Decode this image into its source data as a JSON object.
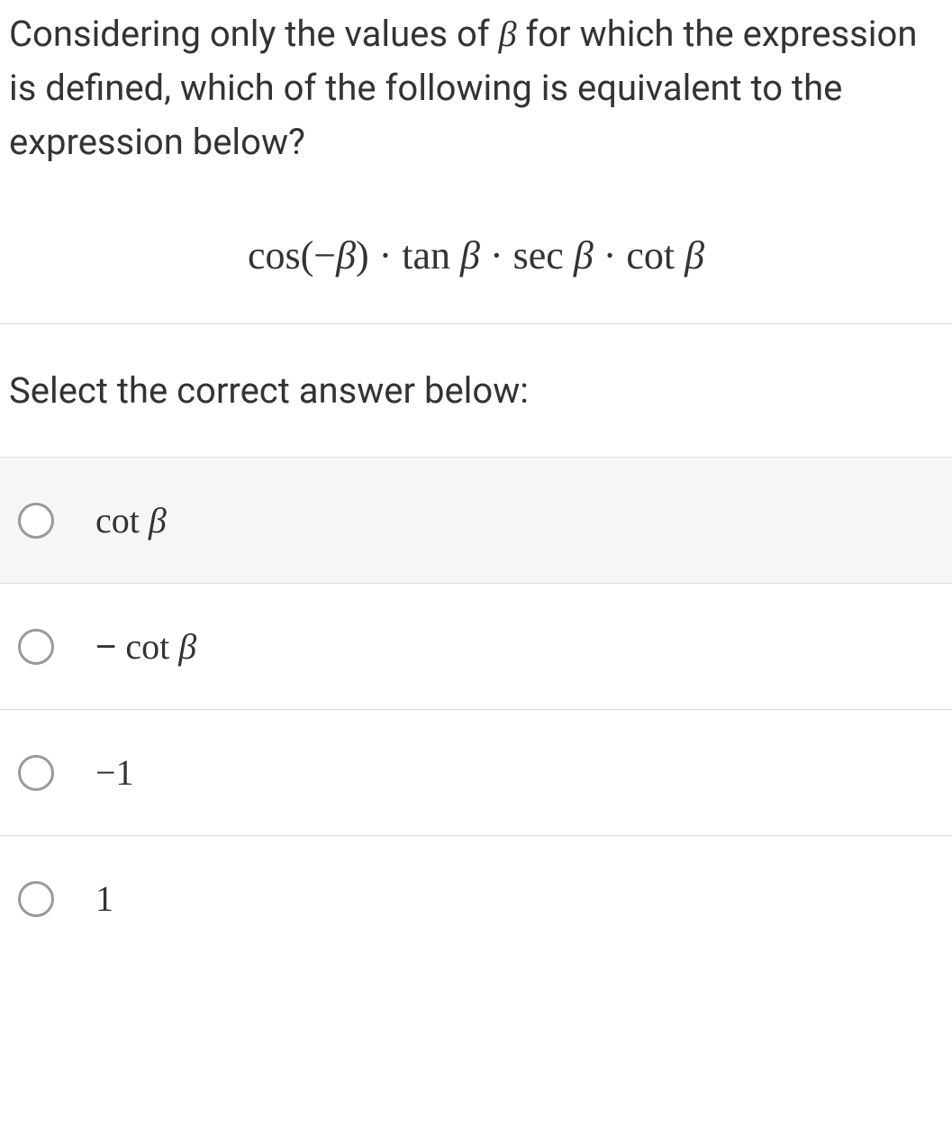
{
  "question": {
    "stem_1": "Considering only the values of ",
    "stem_var": "β",
    "stem_2": " for which the expression is defined, which of the following is equivalent to the expression below?",
    "expression": "cos(−β) · tan β · sec β · cot β"
  },
  "prompt": "Select the correct answer below:",
  "options": [
    {
      "text": "cot β",
      "highlight": true
    },
    {
      "text": "− cot β",
      "highlight": false
    },
    {
      "text": "−1",
      "highlight": false
    },
    {
      "text": "1",
      "highlight": false
    }
  ]
}
